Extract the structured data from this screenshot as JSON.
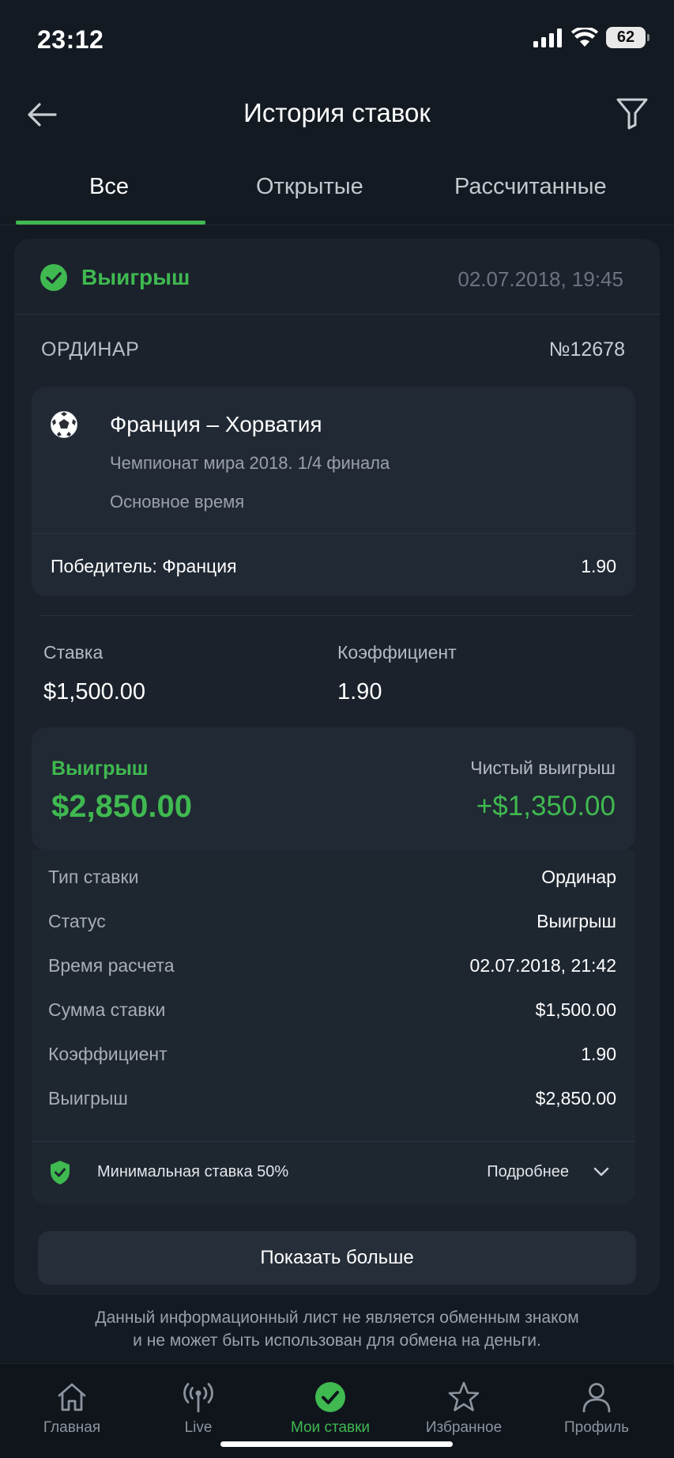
{
  "status_bar": {
    "time": "23:12",
    "battery": "62"
  },
  "header": {
    "title": "История ставок"
  },
  "tabs": [
    {
      "label": "Все",
      "active": true
    },
    {
      "label": "Открытые",
      "active": false
    },
    {
      "label": "Рассчитанные",
      "active": false
    }
  ],
  "bet": {
    "status": "Выигрыш",
    "date": "02.07.2018, 19:45",
    "type": "ОРДИНАР",
    "number": "№12678",
    "event": {
      "name": "Франция – Хорватия",
      "tournament": "Чемпионат мира 2018. 1/4 финала",
      "period": "Основное время",
      "outcome": "Победитель: Франция",
      "odds": "1.90"
    },
    "stake_label": "Ставка",
    "stake_value": "$1,500.00",
    "odds_label": "Коэффициент",
    "odds_value": "1.90",
    "win_label": "Выигрыш",
    "win_value": "$2,850.00",
    "net_label": "Чистый выигрыш",
    "net_value": "+$1,350.00",
    "details": [
      {
        "label": "Тип ставки",
        "value": "Ординар"
      },
      {
        "label": "Статус",
        "value": "Выигрыш"
      },
      {
        "label": "Время расчета",
        "value": "02.07.2018, 21:42"
      },
      {
        "label": "Сумма ставки",
        "value": "$1,500.00"
      },
      {
        "label": "Коэффициент",
        "value": "1.90"
      },
      {
        "label": "Выигрыш",
        "value": "$2,850.00"
      }
    ],
    "min_stake": "Минимальная ставка 50%",
    "more_link": "Подробнее",
    "show_more": "Показать больше"
  },
  "disclaimer": {
    "line1": "Данный информационный лист не является обменным знаком",
    "line2": "и не может быть использован для обмена на деньги."
  },
  "bottom_nav": [
    {
      "label": "Главная",
      "icon": "home-icon",
      "active": false
    },
    {
      "label": "Live",
      "icon": "live-icon",
      "active": false
    },
    {
      "label": "Мои ставки",
      "icon": "my-bets-icon",
      "active": true
    },
    {
      "label": "Избранное",
      "icon": "star-icon",
      "active": false
    },
    {
      "label": "Профиль",
      "icon": "profile-icon",
      "active": false
    }
  ],
  "colors": {
    "accent": "#3fb950",
    "background": "#141a22",
    "card": "#1b222c"
  }
}
